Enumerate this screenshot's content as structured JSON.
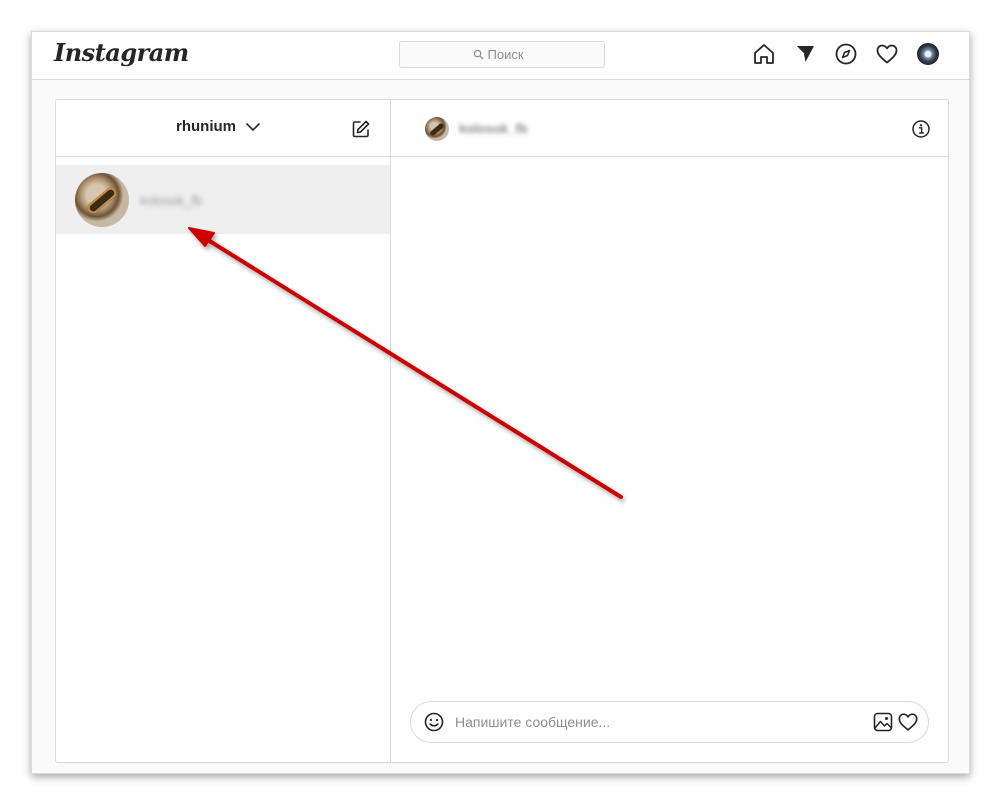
{
  "topbar": {
    "logo": "Instagram",
    "search_placeholder": "Поиск",
    "icons": [
      "home-icon",
      "direct-icon",
      "explore-icon",
      "activity-heart-icon",
      "profile-avatar"
    ]
  },
  "sidebar": {
    "account_name": "rhunium",
    "threads": [
      {
        "name": "kolosok_fb"
      }
    ]
  },
  "conversation": {
    "username": "kolosok_fb",
    "message_placeholder": "Напишите сообщение..."
  },
  "annotation": {
    "color": "#cc0000"
  }
}
